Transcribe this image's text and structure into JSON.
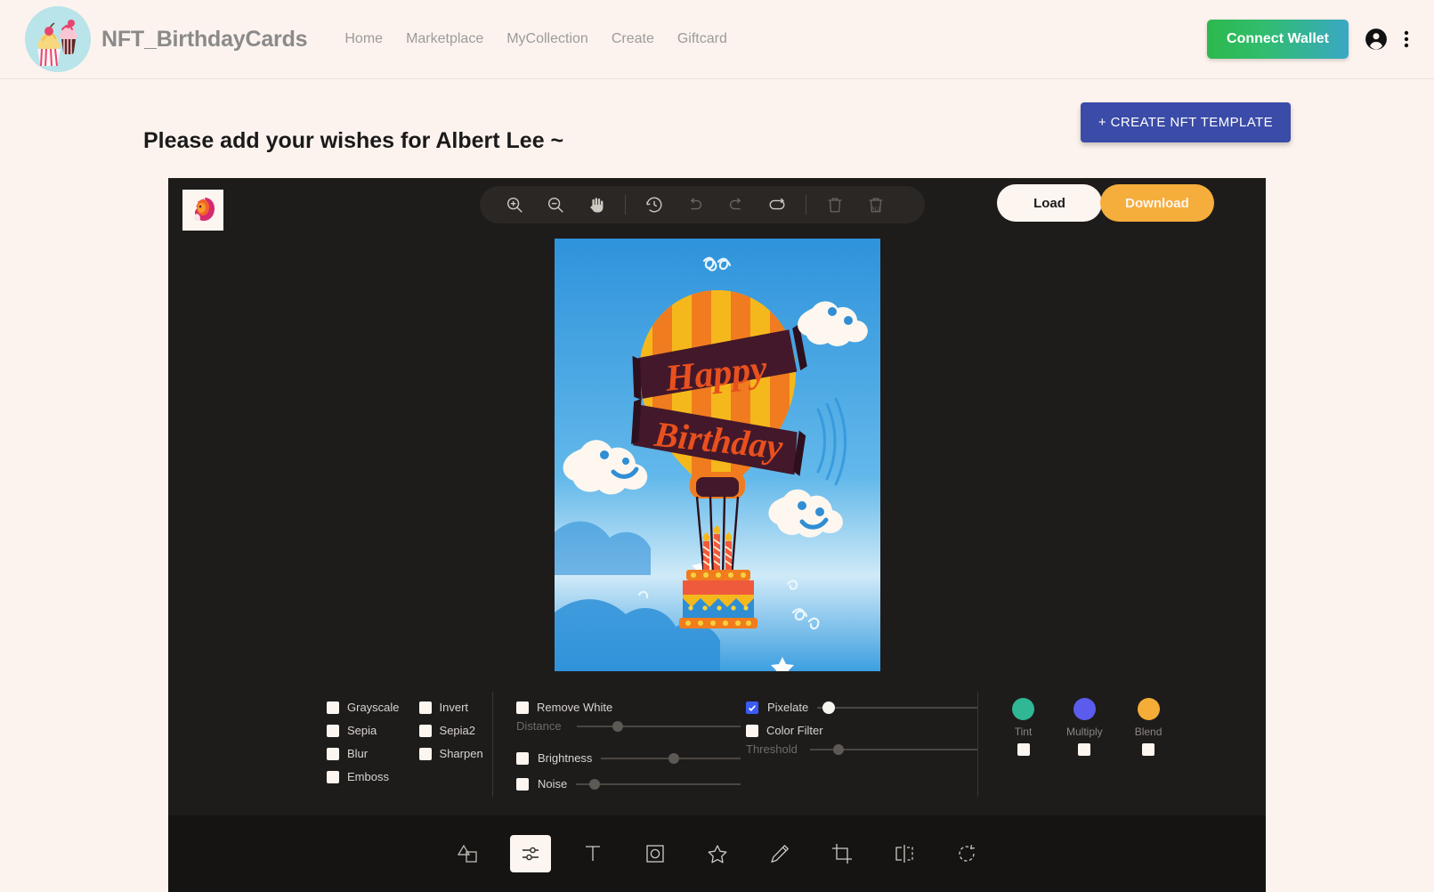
{
  "header": {
    "brand": "NFT_BirthdayCards",
    "logo_icon": "cupcake-logo-icon",
    "logo_bg": "#b8e4ea",
    "nav": [
      {
        "label": "Home",
        "name": "nav-home"
      },
      {
        "label": "Marketplace",
        "name": "nav-marketplace"
      },
      {
        "label": "MyCollection",
        "name": "nav-mycollection"
      },
      {
        "label": "Create",
        "name": "nav-create"
      },
      {
        "label": "Giftcard",
        "name": "nav-giftcard"
      }
    ],
    "connect_wallet": "Connect Wallet",
    "connect_wallet_gradient": [
      "#2db84c",
      "#3aa8c4"
    ],
    "account_icon": "account-circle-icon",
    "menu_icon": "more-vertical-icon"
  },
  "page": {
    "title": "Please add your wishes for Albert Lee ~",
    "create_template_button": "+ CREATE NFT TEMPLATE",
    "create_template_color": "#3b4ba8",
    "background": "#fdf3ee"
  },
  "editor": {
    "background": "#1e1c1b",
    "thumbnail_name": "lion-logo-thumbnail",
    "toolbar": [
      {
        "name": "zoom-in-icon",
        "label": "Zoom In",
        "state": "enabled"
      },
      {
        "name": "zoom-out-icon",
        "label": "Zoom Out",
        "state": "enabled"
      },
      {
        "name": "hand-icon",
        "label": "Hand",
        "state": "enabled"
      },
      {
        "name": "history-icon",
        "label": "History",
        "state": "enabled"
      },
      {
        "name": "undo-icon",
        "label": "Undo",
        "state": "dimmed"
      },
      {
        "name": "redo-icon",
        "label": "Redo",
        "state": "dimmed"
      },
      {
        "name": "reset-icon",
        "label": "Reset",
        "state": "enabled"
      },
      {
        "name": "delete-icon",
        "label": "Delete",
        "state": "dimmed"
      },
      {
        "name": "delete-all-icon",
        "label": "Delete All",
        "state": "dimmed"
      }
    ],
    "load_button": "Load",
    "download_button": "Download",
    "download_color": "#f5ae3c",
    "canvas_image": {
      "description": "Happy Birthday hot air balloon card",
      "banner_line1": "Happy",
      "banner_line2": "Birthday",
      "sky_color": "#3b9bdd",
      "balloon_colors": [
        "#f07c1f",
        "#f5b81c"
      ],
      "banner_color": "#43182a",
      "candle_count": 3
    }
  },
  "filters": {
    "group1": [
      {
        "label": "Grayscale",
        "checked": false,
        "name": "filter-grayscale"
      },
      {
        "label": "Sepia",
        "checked": false,
        "name": "filter-sepia"
      },
      {
        "label": "Blur",
        "checked": false,
        "name": "filter-blur"
      },
      {
        "label": "Emboss",
        "checked": false,
        "name": "filter-emboss"
      }
    ],
    "group2": [
      {
        "label": "Invert",
        "checked": false,
        "name": "filter-invert"
      },
      {
        "label": "Sepia2",
        "checked": false,
        "name": "filter-sepia2"
      },
      {
        "label": "Sharpen",
        "checked": false,
        "name": "filter-sharpen"
      }
    ],
    "group3": {
      "remove_white": {
        "label": "Remove White",
        "checked": false
      },
      "distance": {
        "label": "Distance",
        "value": 22,
        "enabled": false
      },
      "brightness": {
        "label": "Brightness",
        "checked": false
      },
      "brightness_slider": {
        "value": 50
      },
      "noise": {
        "label": "Noise",
        "checked": false
      },
      "noise_slider": {
        "value": 10
      }
    },
    "group4": {
      "pixelate": {
        "label": "Pixelate",
        "checked": true
      },
      "pixelate_slider": {
        "value": 5
      },
      "color_filter": {
        "label": "Color Filter",
        "checked": false
      },
      "threshold": {
        "label": "Threshold",
        "value": 14,
        "enabled": false
      }
    },
    "swatches": [
      {
        "label": "Tint",
        "color": "#2fb893",
        "checked": false,
        "name": "swatch-tint"
      },
      {
        "label": "Multiply",
        "color": "#5b5ced",
        "checked": false,
        "name": "swatch-multiply"
      },
      {
        "label": "Blend",
        "color": "#f5ad37",
        "checked": false,
        "name": "swatch-blend"
      }
    ]
  },
  "bottom_toolbar": [
    {
      "name": "shapes-icon",
      "label": "Shape",
      "active": false
    },
    {
      "name": "filter-icon",
      "label": "Filter",
      "active": true
    },
    {
      "name": "text-icon",
      "label": "Text",
      "active": false
    },
    {
      "name": "mask-icon",
      "label": "Mask",
      "active": false
    },
    {
      "name": "icon-star-icon",
      "label": "Icon",
      "active": false
    },
    {
      "name": "draw-icon",
      "label": "Draw",
      "active": false
    },
    {
      "name": "crop-icon",
      "label": "Crop",
      "active": false
    },
    {
      "name": "flip-icon",
      "label": "Flip",
      "active": false
    },
    {
      "name": "rotate-icon",
      "label": "Rotate",
      "active": false
    }
  ]
}
